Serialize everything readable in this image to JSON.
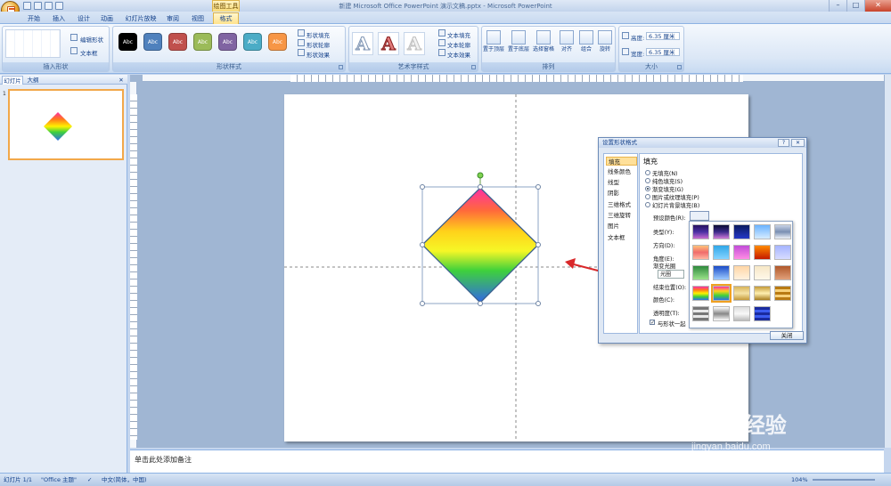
{
  "window": {
    "title": "新建 Microsoft Office PowerPoint 演示文稿.pptx - Microsoft PowerPoint",
    "minimize": "–",
    "maximize": "□",
    "close": "✕"
  },
  "ribbon_tabs": {
    "context_label": "绘图工具",
    "tabs": [
      "开始",
      "插入",
      "设计",
      "动画",
      "幻灯片放映",
      "审阅",
      "视图",
      "格式"
    ],
    "active": "格式"
  },
  "ribbon": {
    "insert_shapes": {
      "label": "插入形状",
      "edit_shape": "编辑形状",
      "textbox": "文本框"
    },
    "shape_styles": {
      "label": "形状样式",
      "abc": "Abc",
      "styles": [
        "#000000",
        "#4f81bd",
        "#c0504d",
        "#9bbb59",
        "#8064a2",
        "#4bacc6",
        "#f79646"
      ],
      "fill": "形状填充",
      "outline": "形状轮廓",
      "effects": "形状效果"
    },
    "wordart": {
      "label": "艺术字样式",
      "letter": "A",
      "text_fill": "文本填充",
      "text_outline": "文本轮廓",
      "text_effects": "文本效果"
    },
    "arrange": {
      "label": "排列",
      "bring_front": "置于顶层",
      "send_back": "置于底层",
      "selection_pane": "选择窗格",
      "align": "对齐",
      "group": "组合",
      "rotate": "旋转"
    },
    "size": {
      "label": "大小",
      "height_label": "高度:",
      "height": "6.35 厘米",
      "width_label": "宽度:",
      "width": "6.35 厘米"
    }
  },
  "left_pane": {
    "tab_slides": "幻灯片",
    "tab_outline": "大纲",
    "close": "✕",
    "slide_number": "1"
  },
  "notes_placeholder": "单击此处添加备注",
  "status": {
    "slide": "幻灯片 1/1",
    "theme": "\"Office 主题\"",
    "language": "中文(简体，中国)",
    "zoom": "104%"
  },
  "dialog": {
    "title": "设置形状格式",
    "help": "?",
    "close_x": "✕",
    "categories": [
      "填充",
      "线条颜色",
      "线型",
      "阴影",
      "三维格式",
      "三维旋转",
      "图片",
      "文本框"
    ],
    "selected_category": "填充",
    "section": "填充",
    "options": [
      "无填充(N)",
      "纯色填充(S)",
      "渐变填充(G)",
      "图片或纹理填充(P)",
      "幻灯片背景填充(B)"
    ],
    "selected_option": "渐变填充(G)",
    "fields": {
      "preset": "预设颜色(R):",
      "type": "类型(Y):",
      "direction": "方向(D):",
      "angle": "角度(E):",
      "stops": "渐变光圈",
      "stop_value": "光圈",
      "stop_position": "结束位置(O):",
      "color": "颜色(C):",
      "transparency": "透明度(T):",
      "rotate_with": "与形状一起"
    },
    "close_button": "关闭"
  },
  "watermark": {
    "brand": "Bai",
    "brand2": "经验",
    "url": "jingyan.baidu.com"
  },
  "colors": {
    "accent": "#15428b",
    "ribbon": "#dbe7f6",
    "selected_tab": "#ffe09a"
  }
}
